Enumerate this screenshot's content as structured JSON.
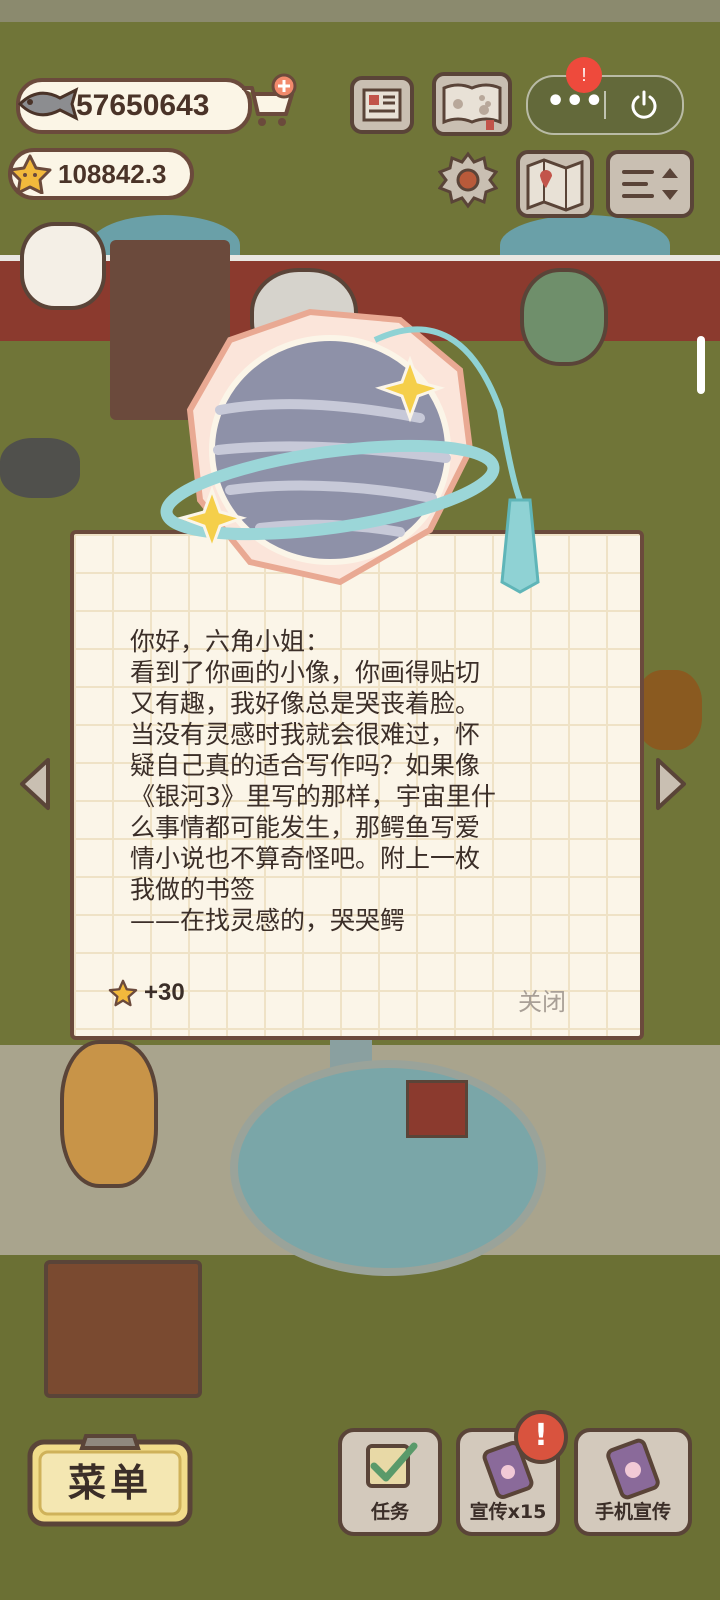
{
  "hud": {
    "fish_count": "57650643",
    "star_count": "108842.3"
  },
  "mini_program_capsule": {
    "more_glyph": "•••",
    "notification_badge": "!"
  },
  "letter": {
    "lines": [
      "你好，六角小姐：",
      "看到了你画的小像，你画得贴切",
      "又有趣，我好像总是哭丧着脸。",
      "当没有灵感时我就会很难过，怀",
      "疑自己真的适合写作吗？如果像",
      "《银河3》里写的那样，宇宙里什",
      "么事情都可能发生，那鳄鱼写爱",
      "情小说也不算奇怪吧。附上一枚",
      "我做的书签",
      "——在找灵感的，哭哭鳄"
    ],
    "reward": "+30",
    "close_label": "关闭"
  },
  "bottom_bar": {
    "menu_label": "菜单",
    "tasks_label": "任务",
    "promote_label": "宣传x15",
    "promote_alert": "!",
    "phone_promote_label": "手机宣传"
  },
  "colors": {
    "panel_bg": "#fbf5e8",
    "outline": "#6b4a3c",
    "grass": "#707538",
    "alert_red": "#ee4a3c"
  },
  "icons": [
    "fish-icon",
    "star-icon",
    "cart-plus-icon",
    "newspaper-icon",
    "paw-book-icon",
    "gear-icon",
    "map-icon",
    "sort-icon",
    "power-icon",
    "planet-bookmark-icon",
    "checklist-icon",
    "phone-paw-icon"
  ]
}
